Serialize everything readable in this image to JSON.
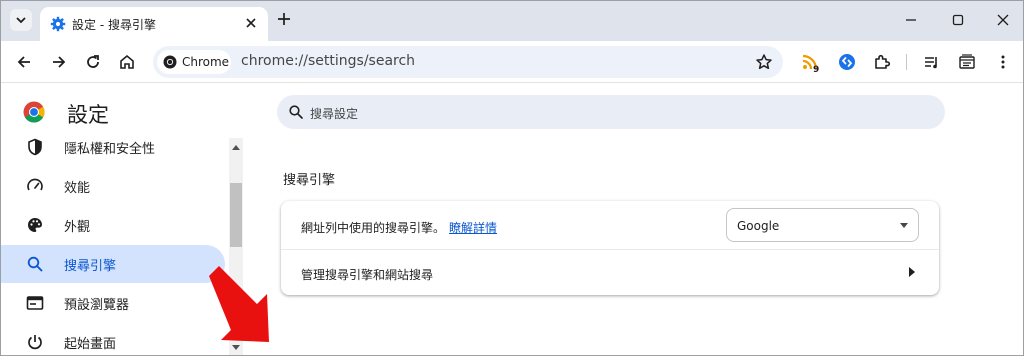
{
  "tab": {
    "title": "設定 - 搜尋引擎"
  },
  "omnibox": {
    "chip_label": "Chrome",
    "url": "chrome://settings/search"
  },
  "extensions": {
    "rss_badge": "9"
  },
  "page": {
    "title": "設定"
  },
  "search": {
    "placeholder": "搜尋設定"
  },
  "sidebar": {
    "items": [
      {
        "label": "隱私權和安全性",
        "icon": "shield-icon"
      },
      {
        "label": "效能",
        "icon": "speedometer-icon"
      },
      {
        "label": "外觀",
        "icon": "palette-icon"
      },
      {
        "label": "搜尋引擎",
        "icon": "search-icon",
        "active": true
      },
      {
        "label": "預設瀏覽器",
        "icon": "browser-window-icon"
      },
      {
        "label": "起始畫面",
        "icon": "power-icon"
      }
    ]
  },
  "main": {
    "section_title": "搜尋引擎",
    "engine_row_label": "網址列中使用的搜尋引擎。",
    "learn_more": "瞭解詳情",
    "engine_selected": "Google",
    "manage_row_label": "管理搜尋引擎和網站搜尋"
  },
  "colors": {
    "accent": "#0b57d0",
    "active_bg": "#d3e3fd",
    "annotation": "#e8110f"
  }
}
